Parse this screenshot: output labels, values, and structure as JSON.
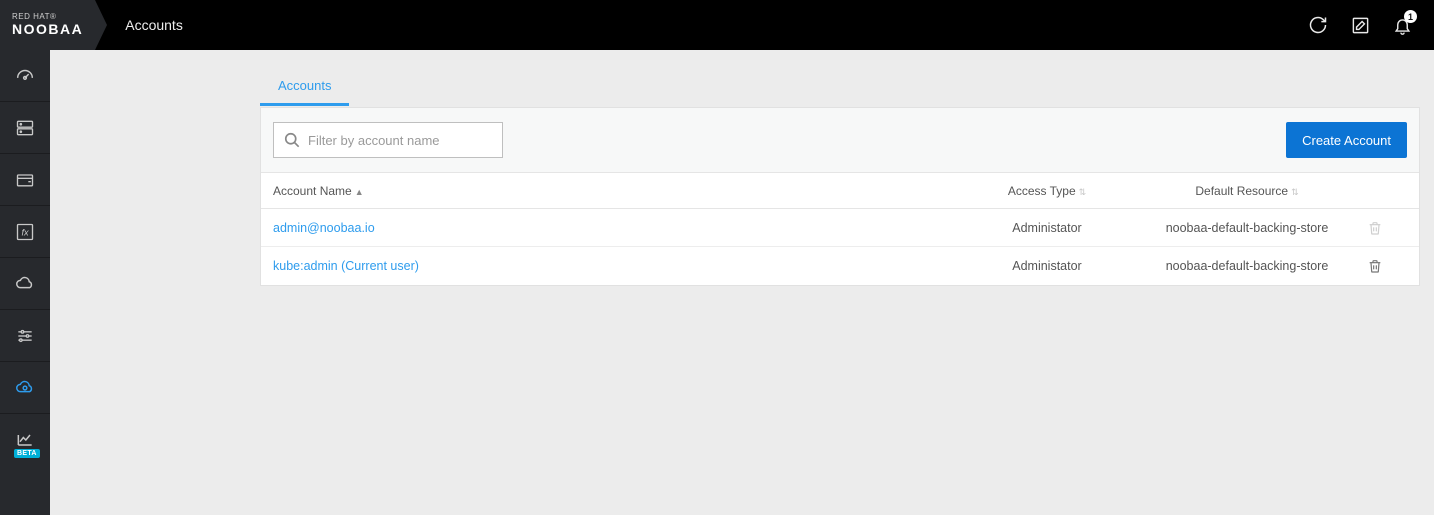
{
  "brand": {
    "line1": "RED HAT®",
    "line2": "NOOBAA"
  },
  "header": {
    "title": "Accounts",
    "notification_count": "1"
  },
  "tabs": {
    "accounts": "Accounts"
  },
  "toolbar": {
    "search_placeholder": "Filter by account name",
    "create_label": "Create Account"
  },
  "table": {
    "headers": {
      "name": "Account Name",
      "access": "Access Type",
      "resource": "Default Resource"
    },
    "rows": [
      {
        "name": "admin@noobaa.io",
        "access": "Administator",
        "resource": "noobaa-default-backing-store",
        "delete_enabled": false
      },
      {
        "name": "kube:admin (Current user)",
        "access": "Administator",
        "resource": "noobaa-default-backing-store",
        "delete_enabled": true
      }
    ]
  },
  "sidebar": {
    "beta_label": "BETA"
  }
}
